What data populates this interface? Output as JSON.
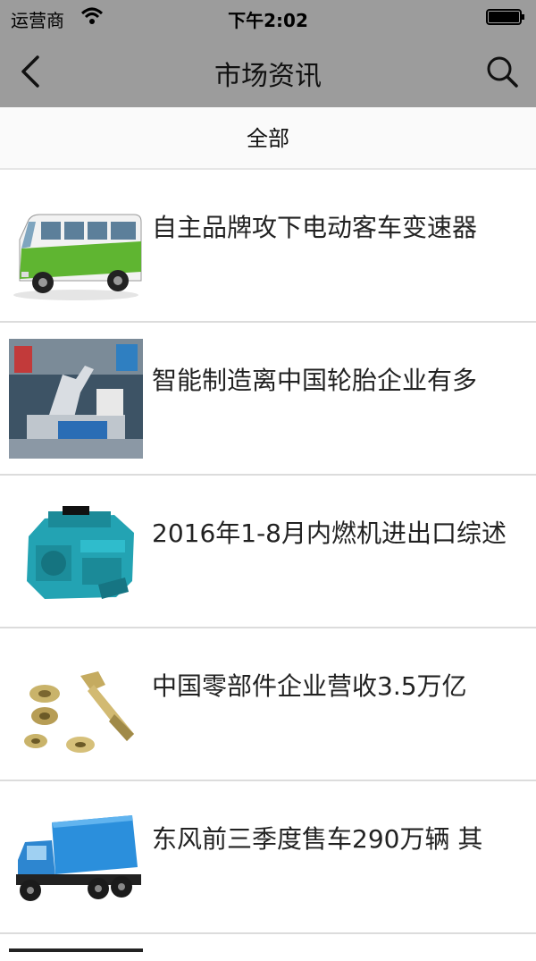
{
  "status_bar": {
    "carrier": "运营商",
    "time": "下午2:02"
  },
  "nav": {
    "title": "市场资讯",
    "back_icon": "chevron-left-icon",
    "search_icon": "search-icon"
  },
  "filter": {
    "label": "全部"
  },
  "news": [
    {
      "title": "自主品牌攻下电动客车变速器",
      "image": "green-bus"
    },
    {
      "title": "智能制造离中国轮胎企业有多",
      "image": "factory-robot"
    },
    {
      "title": "2016年1-8月内燃机进出口综述",
      "image": "engine"
    },
    {
      "title": "中国零部件企业营收3.5万亿",
      "image": "bolts-and-bushings"
    },
    {
      "title": "东风前三季度售车290万辆 其",
      "image": "blue-dump-truck"
    }
  ],
  "colors": {
    "nav_background": "#9c9c9c",
    "divider": "#dcdcdc"
  }
}
